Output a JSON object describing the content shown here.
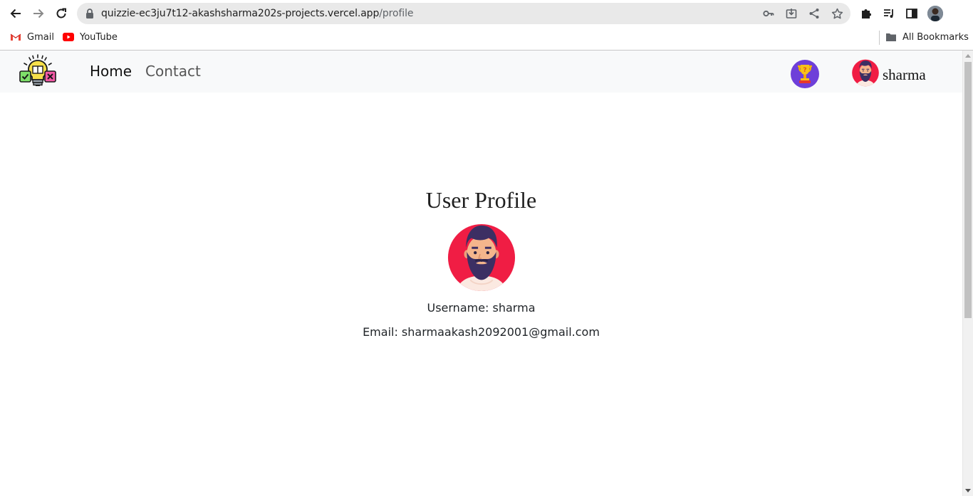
{
  "browser": {
    "url_host": "quizzie-ec3ju7t12-akashsharma202s-projects.vercel.app",
    "url_path": "/profile",
    "bookmarks": [
      {
        "label": "Gmail",
        "icon": "gmail-icon"
      },
      {
        "label": "YouTube",
        "icon": "youtube-icon"
      }
    ],
    "all_bookmarks_label": "All Bookmarks"
  },
  "navbar": {
    "links": [
      {
        "label": "Home"
      },
      {
        "label": "Contact"
      }
    ],
    "username": "sharma",
    "icons": {
      "logo": "quiz-bulb-logo",
      "leaderboard": "trophy-icon",
      "avatar": "bearded-man-avatar"
    }
  },
  "profile": {
    "title": "User Profile",
    "username_line": "Username: sharma",
    "email_line": "Email: sharmaakash2092001@gmail.com"
  },
  "colors": {
    "navbar_bg": "#f8f9fa",
    "avatar_bg": "#f01d44",
    "trophy_bg": "#6e3fd9",
    "beard": "#3c2f63"
  }
}
